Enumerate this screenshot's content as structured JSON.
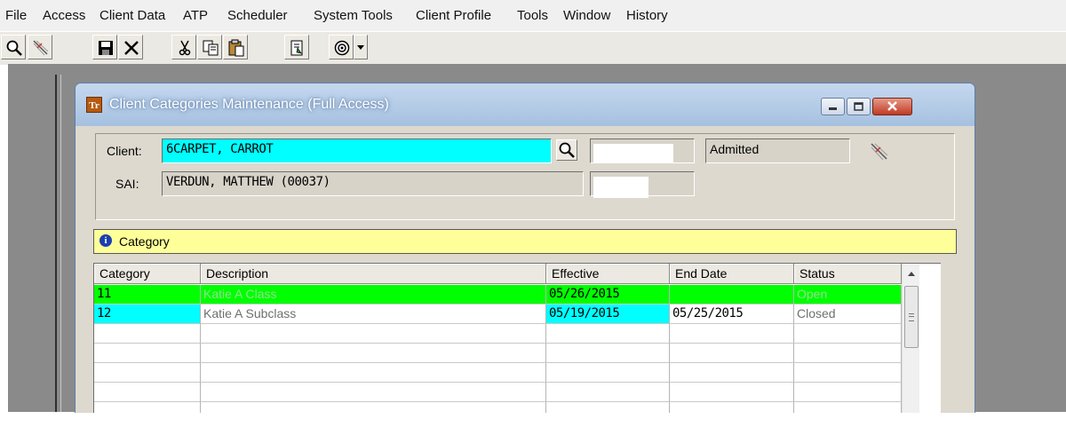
{
  "menu": {
    "items": [
      "File",
      "Access",
      "Client Data",
      "ATP",
      "Scheduler",
      "System Tools",
      "Client Profile",
      "Tools",
      "Window",
      "History"
    ]
  },
  "toolbar": {
    "icons": [
      "search-icon",
      "hatch-icon",
      "save-icon",
      "delete-icon",
      "cut-icon",
      "copy-icon",
      "paste-icon",
      "document-icon",
      "target-icon",
      "dropdown-arrow-icon"
    ]
  },
  "window": {
    "title": "Client Categories Maintenance (Full Access)",
    "app_icon_text": "Tr"
  },
  "client_panel": {
    "client_label": "Client:",
    "client_value": "6CARPET, CARROT",
    "status_value": "Admitted",
    "sai_label": "SAI:",
    "sai_value": "VERDUN, MATTHEW (00037)"
  },
  "category_header": {
    "label": "Category"
  },
  "grid": {
    "columns": [
      "Category",
      "Description",
      "Effective",
      "End Date",
      "Status"
    ],
    "rows": [
      {
        "category": "11",
        "description": "Katie A Class",
        "effective": "05/26/2015",
        "end_date": "",
        "status": "Open"
      },
      {
        "category": "12",
        "description": "Katie A Subclass",
        "effective": "05/19/2015",
        "end_date": "05/25/2015",
        "status": "Closed"
      }
    ]
  },
  "colors": {
    "open_row": "#00ff00",
    "closed_highlight": "#00ffff",
    "header_bar": "#ffff99"
  }
}
